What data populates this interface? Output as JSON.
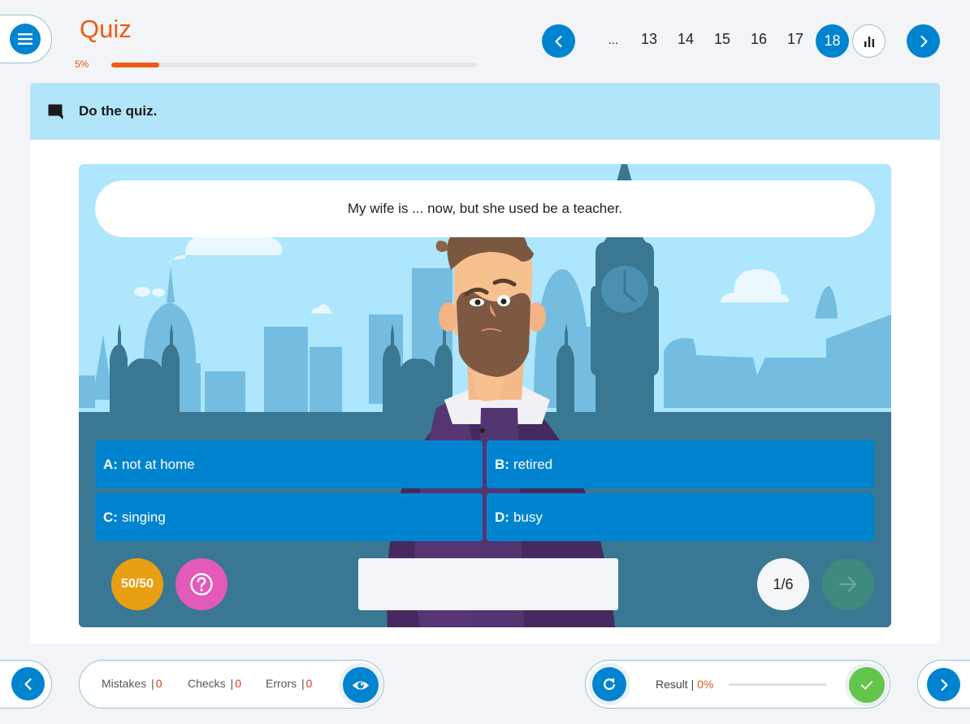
{
  "header": {
    "title": "Quiz",
    "progress_label": "5%",
    "progress_value": 0.05,
    "menu_icon": "hamburger-menu-icon"
  },
  "pager": {
    "prev_icon": "chevron-left-icon",
    "ellipsis": "...",
    "pages": [
      "13",
      "14",
      "15",
      "16",
      "17"
    ],
    "current": "18",
    "stats_icon": "bar-chart-icon",
    "next_icon": "chevron-right-icon"
  },
  "instruction": {
    "icon": "speech-bubble-icon",
    "text": "Do the quiz."
  },
  "quiz": {
    "question": "My wife is ... now, but she used be a teacher.",
    "answers": [
      {
        "letter": "A:",
        "text": "not at home"
      },
      {
        "letter": "B:",
        "text": "retired"
      },
      {
        "letter": "C:",
        "text": "singing"
      },
      {
        "letter": "D:",
        "text": "busy"
      }
    ],
    "fifty_fifty_label": "50/50",
    "hint_icon": "question-circle-icon",
    "feedback_text": "",
    "counter": "1/6",
    "next_icon": "arrow-right-icon"
  },
  "footer": {
    "back_icon": "chevron-left-icon",
    "stats": [
      {
        "label": "Mistakes",
        "value": "0"
      },
      {
        "label": "Checks",
        "value": "0"
      },
      {
        "label": "Errors",
        "value": "0"
      }
    ],
    "separator": "|",
    "eye_icon": "eye-icon",
    "reset_icon": "refresh-icon",
    "result_label": "Result",
    "result_value": "0%",
    "result_progress": 0,
    "check_icon": "checkmark-icon",
    "forward_icon": "chevron-right-icon"
  },
  "colors": {
    "accent": "#0084cf",
    "title": "#f05a0e",
    "answer": "#0084cf",
    "fifty": "#e89f12",
    "hint": "#e35ab8",
    "check": "#63c54a",
    "error_value": "#d93a14"
  }
}
